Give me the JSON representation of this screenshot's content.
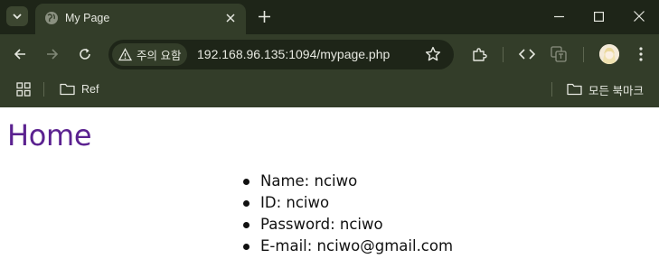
{
  "browser": {
    "tab": {
      "title": "My Page"
    },
    "omnibox": {
      "security_label": "주의 요함",
      "url": "192.168.96.135:1094/mypage.php"
    },
    "bookmarks": {
      "items": [
        {
          "label": "Ref"
        }
      ],
      "all_bookmarks_label": "모든 북마크"
    },
    "theme": {
      "frame": "#1e2518",
      "toolbar": "#333d29",
      "text": "#e6e8e0"
    }
  },
  "page": {
    "heading": "Home",
    "heading_color": "#5b2290",
    "user_info": [
      "Name: nciwo",
      "ID: nciwo",
      "Password: nciwo",
      "E-mail: nciwo@gmail.com"
    ]
  },
  "icons": [
    "tab-search-icon",
    "globe-favicon-icon",
    "close-icon",
    "plus-icon",
    "minimize-icon",
    "maximize-icon",
    "window-close-icon",
    "back-arrow-icon",
    "forward-arrow-icon",
    "reload-icon",
    "warning-icon",
    "star-icon",
    "extensions-icon",
    "code-icon",
    "translate-icon",
    "more-vert-icon",
    "apps-grid-icon",
    "folder-icon"
  ]
}
